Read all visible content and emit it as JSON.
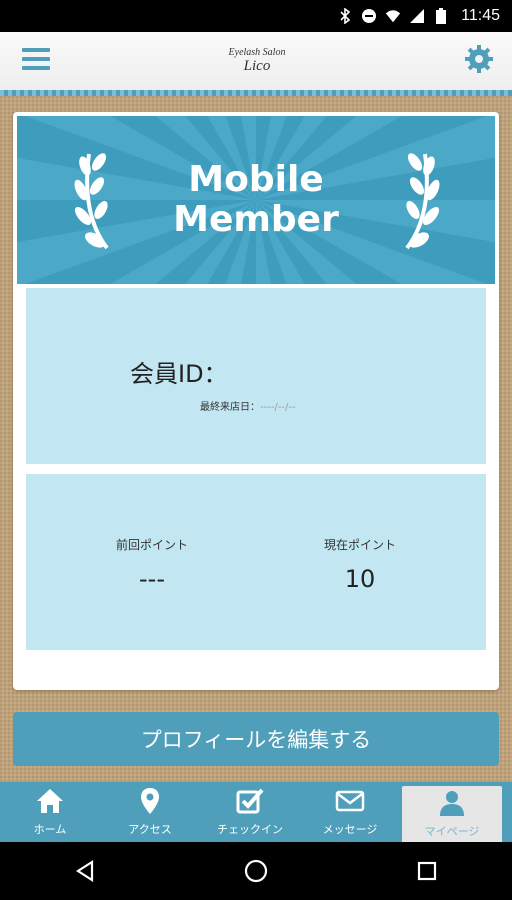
{
  "status_bar": {
    "time": "11:45",
    "icons": [
      "bluetooth-icon",
      "do-not-disturb-icon",
      "wifi-icon",
      "signal-icon",
      "battery-icon"
    ]
  },
  "header": {
    "brand_sub": "Eyelash Salon",
    "brand_name": "Lico",
    "menu_icon": "hamburger-menu-icon",
    "settings_icon": "gear-icon"
  },
  "banner": {
    "title_line1": "Mobile",
    "title_line2": "Member"
  },
  "member": {
    "id_label": "会員ID：",
    "last_visit_label": "最終来店日：",
    "last_visit_value": "----/--/--"
  },
  "points": {
    "previous_label": "前回ポイント",
    "previous_value": "---",
    "current_label": "現在ポイント",
    "current_value": "10"
  },
  "edit_profile_label": "プロフィールを編集する",
  "tabs": [
    {
      "label": "ホーム",
      "icon": "home-icon"
    },
    {
      "label": "アクセス",
      "icon": "map-pin-icon"
    },
    {
      "label": "チェックイン",
      "icon": "checkbox-icon"
    },
    {
      "label": "メッセージ",
      "icon": "envelope-icon"
    },
    {
      "label": "マイページ",
      "icon": "user-icon"
    }
  ],
  "colors": {
    "accent": "#4f9fbb",
    "panel": "#c2e7f2",
    "burlap": "#c8ab82"
  }
}
